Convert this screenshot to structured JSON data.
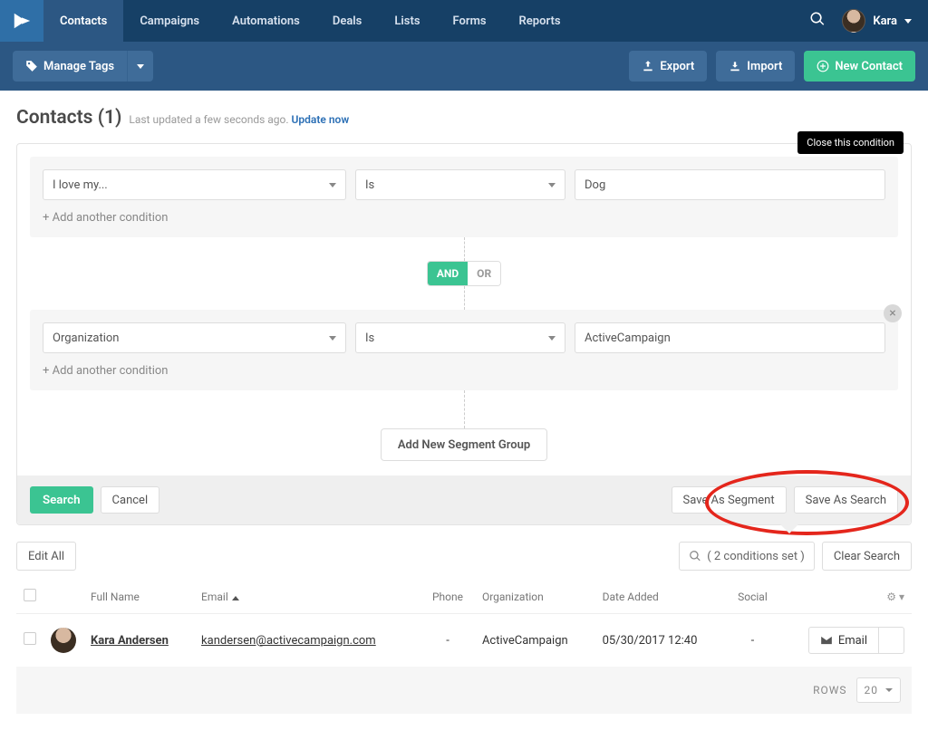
{
  "nav": {
    "items": [
      "Contacts",
      "Campaigns",
      "Automations",
      "Deals",
      "Lists",
      "Forms",
      "Reports"
    ],
    "activeIndex": 0,
    "user": "Kara"
  },
  "subnav": {
    "manageTags": "Manage Tags",
    "export": "Export",
    "import": "Import",
    "newContact": "New Contact"
  },
  "page": {
    "title": "Contacts (1)",
    "lastUpdated": "Last updated a few seconds ago.",
    "updateNow": "Update now"
  },
  "segment": {
    "groups": [
      {
        "field": "I love my...",
        "op": "Is",
        "value": "Dog",
        "tooltip": "Close this condition"
      },
      {
        "field": "Organization",
        "op": "Is",
        "value": "ActiveCampaign"
      }
    ],
    "addCondition": "+ Add another condition",
    "logic": {
      "and": "AND",
      "or": "OR",
      "active": "AND"
    },
    "addGroup": "Add New Segment Group",
    "search": "Search",
    "cancel": "Cancel",
    "saveSegment": "Save As Segment",
    "saveSearch": "Save As Search"
  },
  "toolbar": {
    "editAll": "Edit All",
    "conditionsSet": "( 2 conditions set )",
    "clear": "Clear Search"
  },
  "table": {
    "headers": {
      "fullName": "Full Name",
      "email": "Email",
      "phone": "Phone",
      "org": "Organization",
      "dateAdded": "Date Added",
      "social": "Social"
    },
    "rows": [
      {
        "name": "Kara Andersen",
        "email": "kandersen@activecampaign.com",
        "phone": "-",
        "org": "ActiveCampaign",
        "dateAdded": "05/30/2017 12:40",
        "social": "-",
        "emailBtn": "Email"
      }
    ]
  },
  "pager": {
    "label": "ROWS",
    "value": "20"
  }
}
